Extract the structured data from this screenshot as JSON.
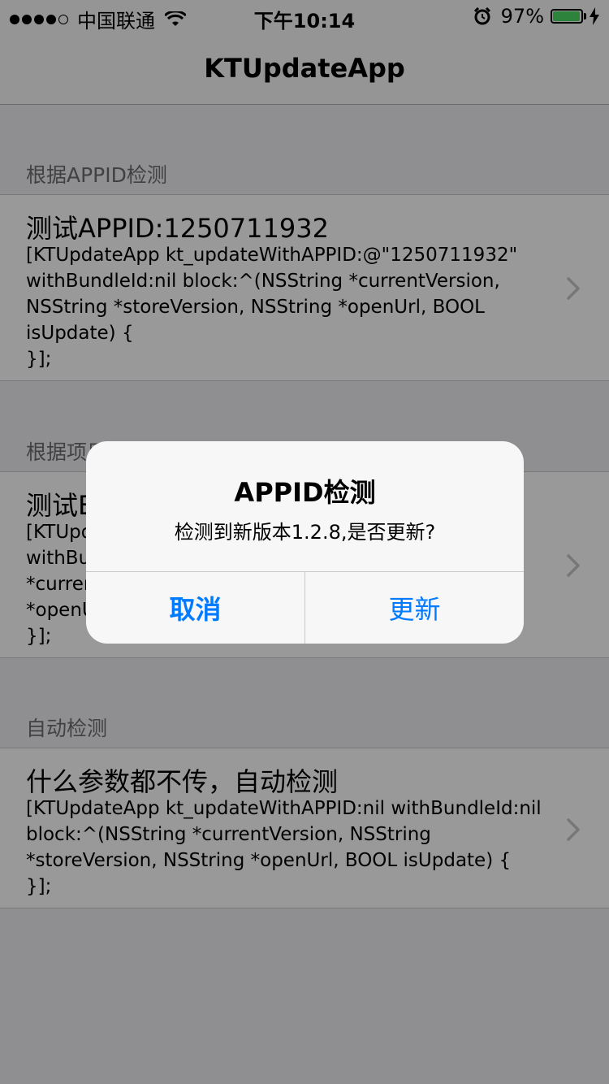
{
  "status_bar": {
    "carrier": "中国联通",
    "time": "下午10:14",
    "battery": "97%",
    "battery_level": 0.97,
    "icons": [
      "signal-dots-icon",
      "wifi-icon",
      "alarm-icon",
      "battery-icon",
      "charging-bolt-icon"
    ]
  },
  "nav": {
    "title": "KTUpdateApp"
  },
  "sections": [
    {
      "header": "根据APPID检测",
      "title": "测试APPID:1250711932",
      "detail": "[KTUpdateApp kt_updateWithAPPID:@\"1250711932\"\nwithBundleId:nil block:^(NSString *currentVersion,\nNSString *storeVersion, NSString *openUrl, BOOL\nisUpdate) {\n}];"
    },
    {
      "header": "根据项目BUNDLE IDENTIFIER检测",
      "title": "测试BUNDLE IDENTIFIER",
      "detail": "[KTUpdateApp kt_updateWithAPPID:nil\nwithBundleId:@\"...\" block:^(NSString\n*currentVersion, NSString *storeVersion, NSString\n*openUrl, BOOL isUpdate) {\n}];"
    },
    {
      "header": "自动检测",
      "title": "什么参数都不传，自动检测",
      "detail": "[KTUpdateApp kt_updateWithAPPID:nil withBundleId:nil\nblock:^(NSString *currentVersion, NSString\n*storeVersion, NSString *openUrl, BOOL isUpdate) {\n}];"
    }
  ],
  "alert": {
    "title": "APPID检测",
    "message": "检测到新版本1.2.8,是否更新?",
    "cancel_label": "取消",
    "confirm_label": "更新"
  },
  "colors": {
    "accent": "#007aff",
    "battery": "#4cd964",
    "background": "#efeff4"
  }
}
